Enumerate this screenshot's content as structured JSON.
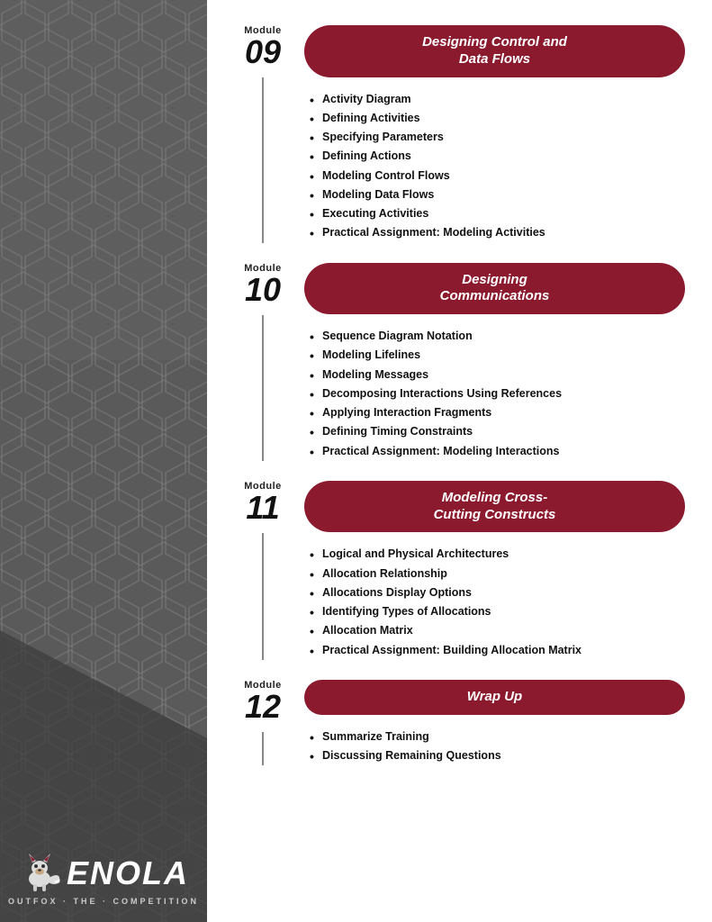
{
  "sidebar": {
    "tagline": "OUTFOX · THE · COMPETITION",
    "logo": "ENOLA"
  },
  "modules": [
    {
      "id": "mod09",
      "number": "09",
      "word": "Module",
      "title": "Designing Control and\nData Flows",
      "title_single_line": false,
      "topics": [
        "Activity Diagram",
        "Defining Activities",
        "Specifying Parameters",
        "Defining Actions",
        "Modeling Control Flows",
        "Modeling Data Flows",
        "Executing Activities",
        "Practical Assignment: Modeling Activities"
      ]
    },
    {
      "id": "mod10",
      "number": "10",
      "word": "Module",
      "title": "Designing\nCommunications",
      "title_single_line": false,
      "topics": [
        "Sequence Diagram Notation",
        "Modeling Lifelines",
        "Modeling Messages",
        "Decomposing Interactions Using References",
        "Applying Interaction Fragments",
        "Defining Timing Constraints",
        "Practical Assignment: Modeling Interactions"
      ]
    },
    {
      "id": "mod11",
      "number": "11",
      "word": "Module",
      "title": "Modeling Cross-\nCutting Constructs",
      "title_single_line": false,
      "topics": [
        "Logical and Physical Architectures",
        "Allocation Relationship",
        "Allocations Display Options",
        "Identifying Types of Allocations",
        "Allocation Matrix",
        "Practical Assignment: Building Allocation Matrix"
      ]
    },
    {
      "id": "mod12",
      "number": "12",
      "word": "Module",
      "title": "Wrap Up",
      "title_single_line": true,
      "topics": [
        "Summarize Training",
        "Discussing Remaining Questions"
      ]
    }
  ]
}
